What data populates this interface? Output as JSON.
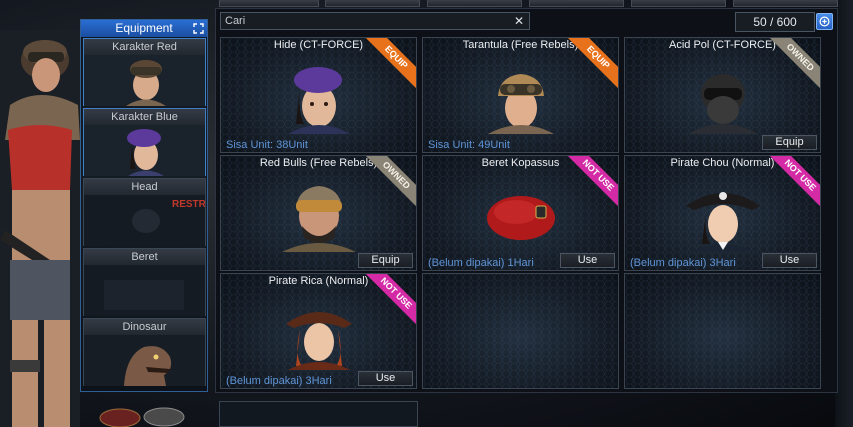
{
  "search": {
    "value": "Cari",
    "clear_icon": "close-icon"
  },
  "inventory": {
    "count": "50 / 600",
    "add_icon": "plus-circle-icon"
  },
  "equipment": {
    "title": "Equipment",
    "expand_icon": "expand-icon",
    "slots": [
      {
        "label": "Karakter Red",
        "art": "female-soldier-goggles"
      },
      {
        "label": "Karakter Blue",
        "art": "female-soldier-purple-beret"
      },
      {
        "label": "Head",
        "art": ""
      },
      {
        "label": "Beret",
        "art": ""
      },
      {
        "label": "Dinosaur",
        "art": "dinosaur-head"
      }
    ]
  },
  "backdrop": {
    "wall_text": "RESTR"
  },
  "items": [
    {
      "name": "Hide (CT-FORCE)",
      "ribbon": "EQUIP",
      "info": "Sisa Unit: 38Unit",
      "button": "",
      "art": "purple-beret-woman"
    },
    {
      "name": "Tarantula (Free Rebels)",
      "ribbon": "EQUIP",
      "info": "Sisa Unit: 49Unit",
      "button": "",
      "art": "goggles-woman"
    },
    {
      "name": "Acid Pol (CT-FORCE)",
      "ribbon": "OWNED",
      "info": "",
      "button": "Equip",
      "art": "masked-soldier"
    },
    {
      "name": "Red Bulls (Free Rebels)",
      "ribbon": "OWNED",
      "info": "",
      "button": "Equip",
      "art": "bearded-soldier-goggles"
    },
    {
      "name": "Beret Kopassus",
      "ribbon": "NOT USE",
      "info": "(Belum dipakai) 1Hari",
      "button": "Use",
      "art": "red-beret"
    },
    {
      "name": "Pirate Chou (Normal)",
      "ribbon": "NOT USE",
      "info": "(Belum dipakai) 3Hari",
      "button": "Use",
      "art": "pirate-woman"
    },
    {
      "name": "Pirate Rica (Normal)",
      "ribbon": "NOT USE",
      "info": "(Belum dipakai) 3Hari",
      "button": "Use",
      "art": "pirate-redhead"
    },
    {
      "name": "",
      "ribbon": "",
      "info": "",
      "button": "",
      "art": ""
    },
    {
      "name": "",
      "ribbon": "",
      "info": "",
      "button": "",
      "art": ""
    }
  ],
  "colors": {
    "accent": "#2a6ed4",
    "equip_ribbon": "#e8721c",
    "owned_ribbon": "#8a8476",
    "notuse_ribbon": "#d42aa6",
    "info_text": "#5f95d8"
  }
}
